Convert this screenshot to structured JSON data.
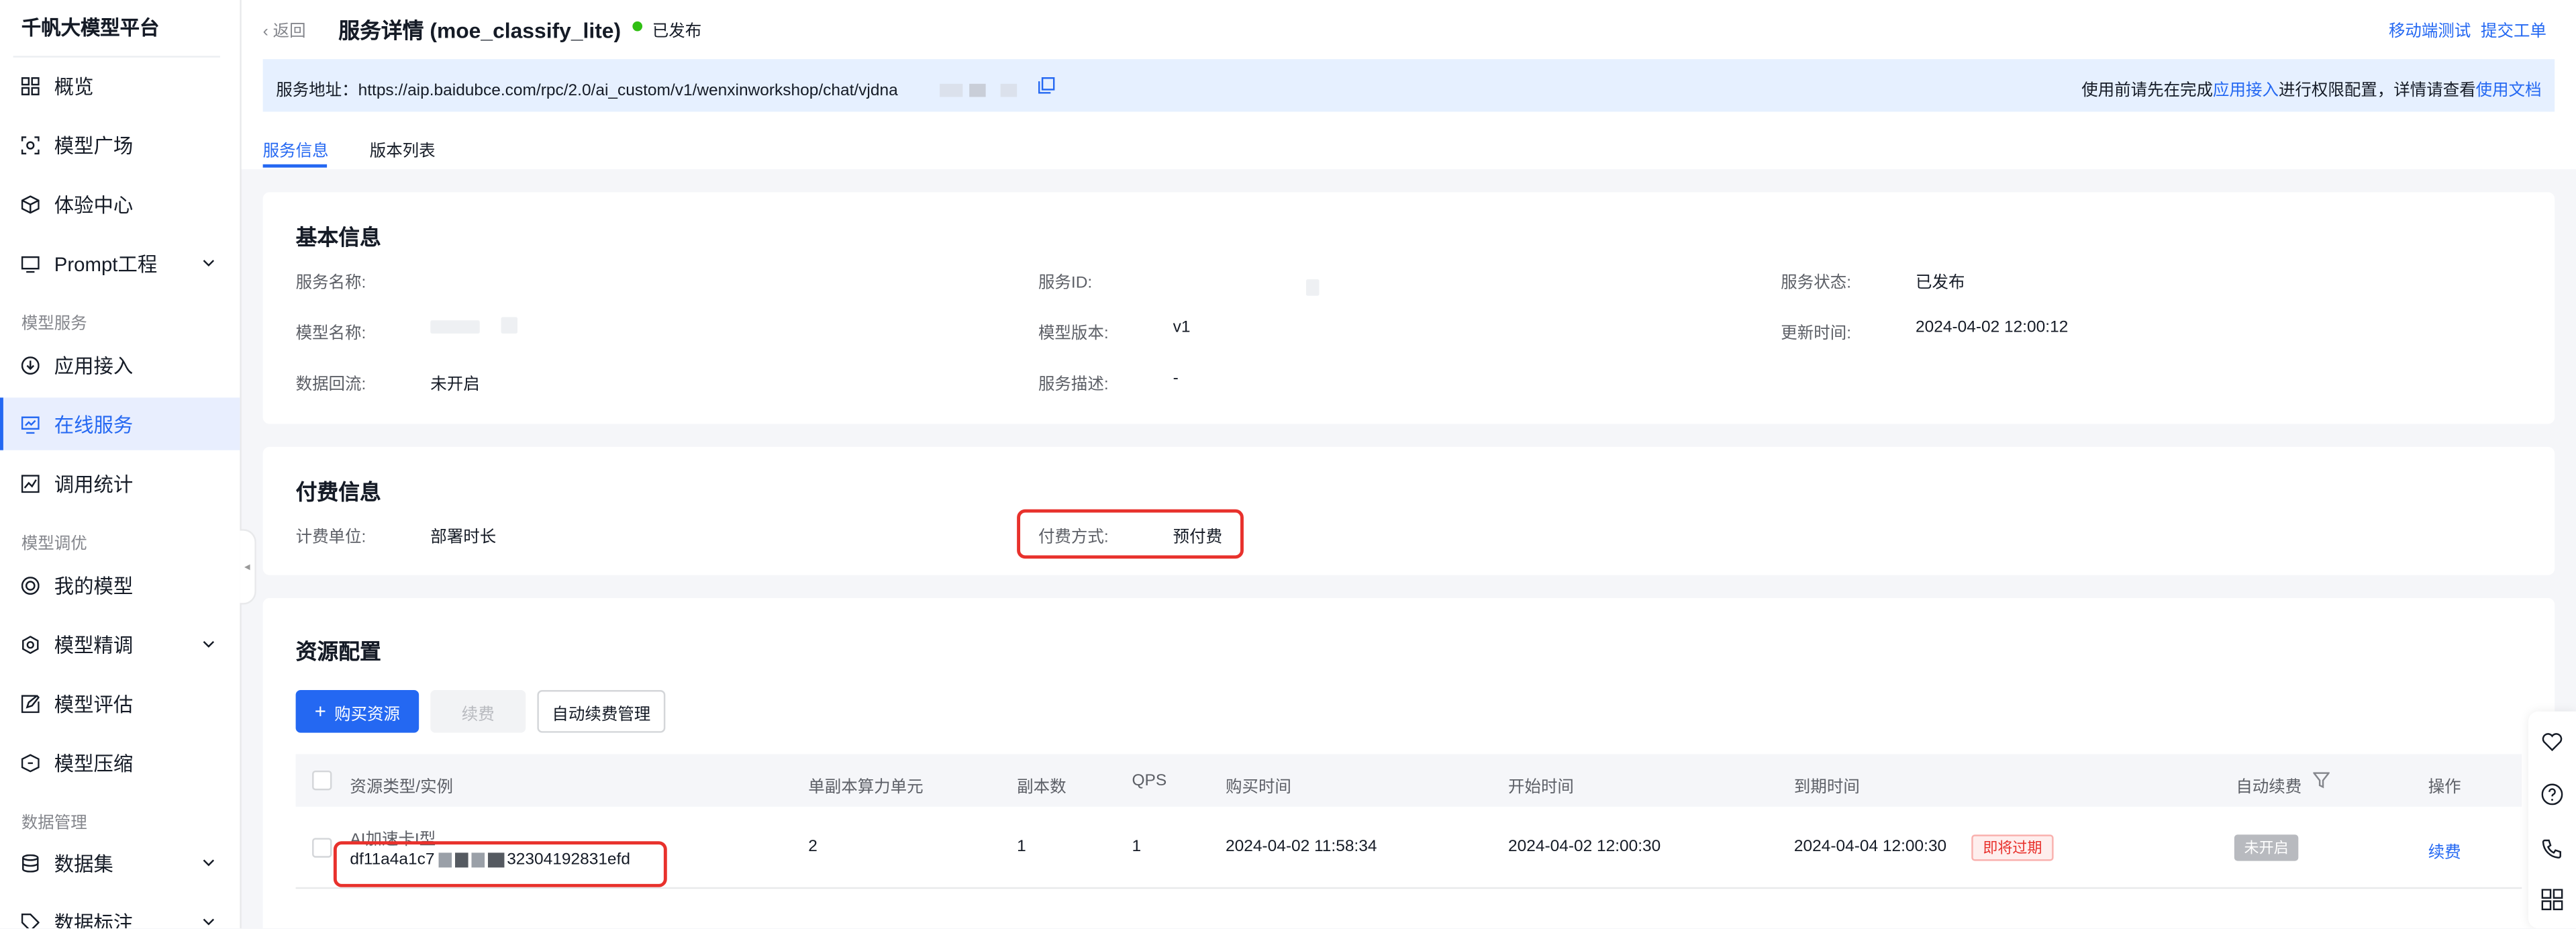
{
  "sidebar": {
    "brand": "千帆大模型平台",
    "items": [
      {
        "label": "概览",
        "icon": "grid-icon"
      },
      {
        "label": "模型广场",
        "icon": "scan-icon"
      },
      {
        "label": "体验中心",
        "icon": "cube-icon"
      },
      {
        "label": "Prompt工程",
        "icon": "prompt-icon"
      },
      {
        "label": "应用接入",
        "icon": "download-icon"
      },
      {
        "label": "在线服务",
        "icon": "monitor-icon"
      },
      {
        "label": "调用统计",
        "icon": "chart-icon"
      },
      {
        "label": "我的模型",
        "icon": "target-icon"
      },
      {
        "label": "模型精调",
        "icon": "gear-hex-icon"
      },
      {
        "label": "模型评估",
        "icon": "edit-icon"
      },
      {
        "label": "模型压缩",
        "icon": "compress-icon"
      },
      {
        "label": "数据集",
        "icon": "database-icon"
      },
      {
        "label": "数据标注",
        "icon": "tag-icon"
      }
    ],
    "groups": [
      "模型服务",
      "模型调优",
      "数据管理"
    ]
  },
  "header": {
    "back": "返回",
    "title": "服务详情 (moe_classify_lite)",
    "status": "已发布",
    "links": [
      "移动端测试",
      "提交工单"
    ]
  },
  "notice": {
    "address_label": "服务地址：",
    "address": "https://aip.baidubce.com/rpc/2.0/ai_custom/v1/wenxinworkshop/chat/vjdna",
    "pre": "使用前请先在完成",
    "link1": "应用接入",
    "mid": "进行权限配置，详情请查看",
    "link2": "使用文档"
  },
  "tabs": [
    "服务信息",
    "版本列表"
  ],
  "basic": {
    "title": "基本信息",
    "service_name_k": "服务名称:",
    "service_id_k": "服务ID:",
    "service_status_k": "服务状态:",
    "service_status_v": "已发布",
    "model_name_k": "模型名称:",
    "model_version_k": "模型版本:",
    "model_version_v": "v1",
    "update_time_k": "更新时间:",
    "update_time_v": "2024-04-02 12:00:12",
    "data_reflow_k": "数据回流:",
    "data_reflow_v": "未开启",
    "service_desc_k": "服务描述:",
    "service_desc_v": "-"
  },
  "billing": {
    "title": "付费信息",
    "unit_k": "计费单位:",
    "unit_v": "部署时长",
    "method_k": "付费方式:",
    "method_v": "预付费"
  },
  "resource": {
    "title": "资源配置",
    "buy_btn": "购买资源",
    "renew_btn": "续费",
    "auto_renew_btn": "自动续费管理",
    "columns": [
      "资源类型/实例",
      "单副本算力单元",
      "副本数",
      "QPS",
      "购买时间",
      "开始时间",
      "到期时间",
      "自动续费",
      "操作"
    ],
    "row": {
      "type": "AI加速卡I型",
      "instance_a": "df11a4a1c7",
      "instance_b": "32304192831efd",
      "units": "2",
      "replicas": "1",
      "qps": "1",
      "buy_time": "2024-04-02 11:58:34",
      "start_time": "2024-04-02 12:00:30",
      "expire_time": "2024-04-04 12:00:30",
      "expire_tag": "即将过期",
      "auto_renew": "未开启",
      "action": "续费"
    }
  }
}
